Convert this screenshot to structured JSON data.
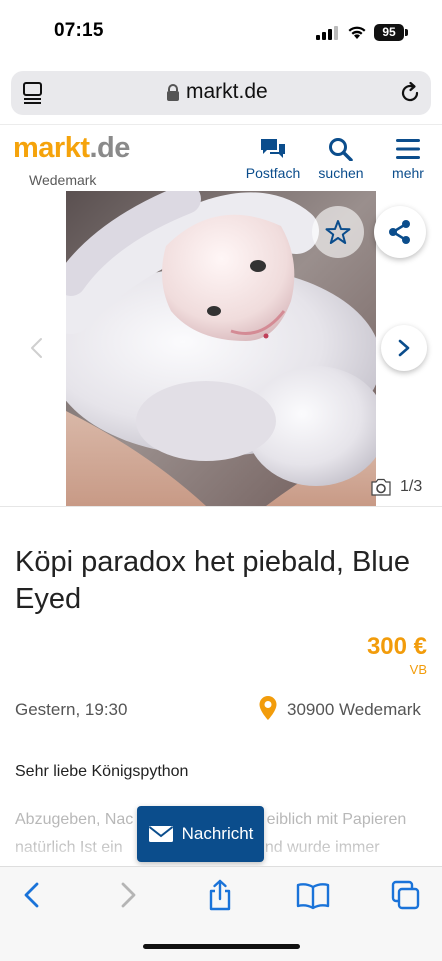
{
  "status_bar": {
    "time": "07:15",
    "battery": "95"
  },
  "browser": {
    "url": "markt.de"
  },
  "site": {
    "logo_part1": "markt",
    "logo_part2": ".de",
    "location": "Wedemark",
    "nav": [
      {
        "label": "Postfach",
        "icon": "chat-bubbles-icon"
      },
      {
        "label": "suchen",
        "icon": "search-icon"
      },
      {
        "label": "mehr",
        "icon": "hamburger-menu-icon"
      }
    ]
  },
  "gallery": {
    "counter": "1/3"
  },
  "listing": {
    "title": "Köpi paradox het piebald, Blue Eyed",
    "price": "300 €",
    "price_suffix": "VB",
    "date": "Gestern, 19:30",
    "location": "30900 Wedemark",
    "subtitle": "Sehr liebe Königspython",
    "description": "Abzugeben, Nac                              eiblich mit Papieren natürlich Ist ein                              und wurde immer"
  },
  "contact": {
    "message_label": "Nachricht"
  },
  "colors": {
    "brand_orange": "#f5a30b",
    "brand_blue": "#0b4d8c",
    "price": "#f29c0b"
  }
}
